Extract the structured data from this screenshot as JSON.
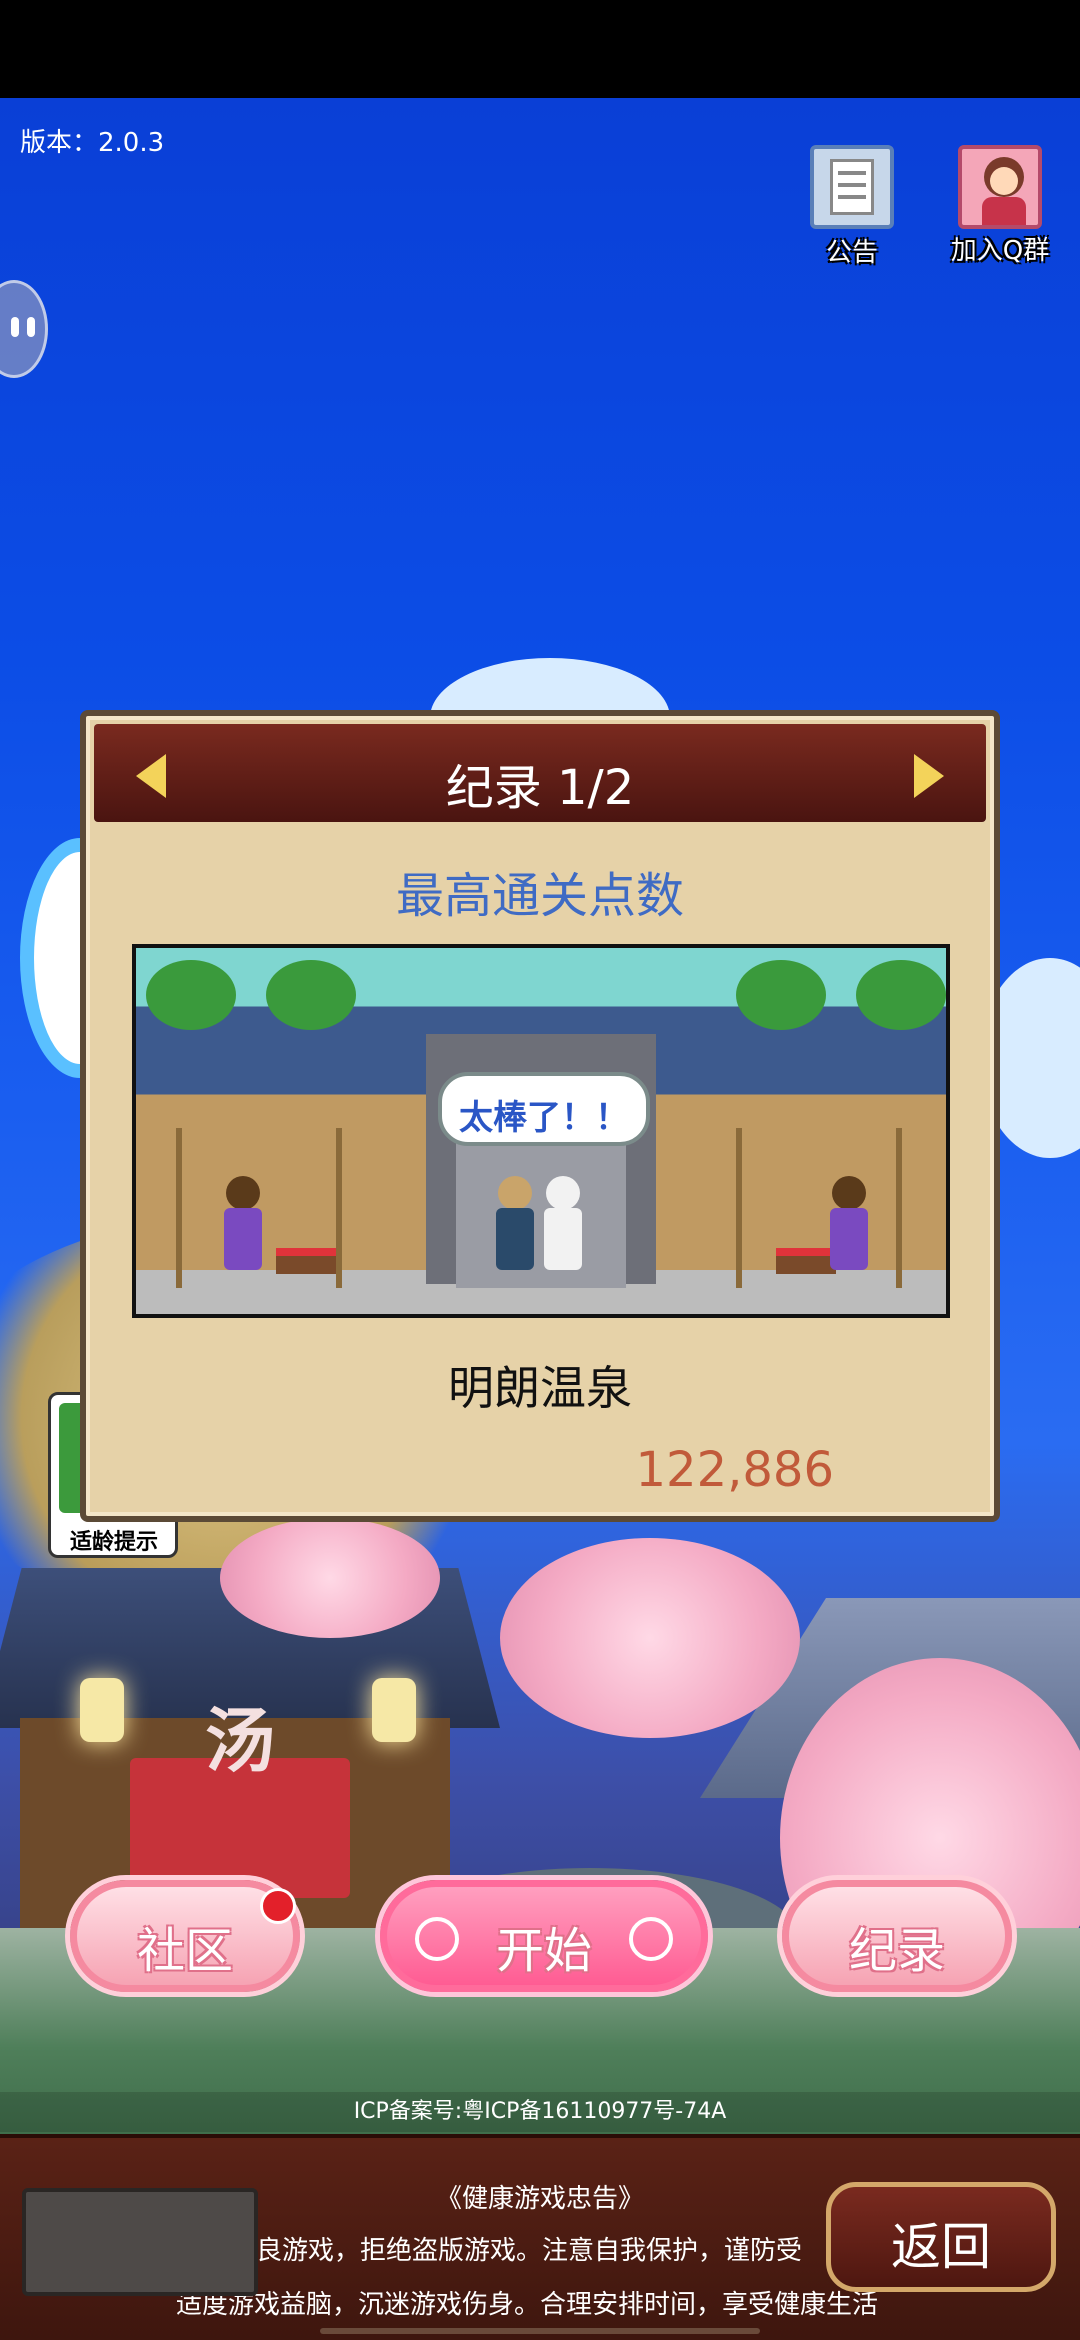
{
  "version_text": "版本：2.0.3",
  "top_icons": {
    "notice_label": "公告",
    "qq_label": "加入Q群"
  },
  "age_badge_label": "适龄提示",
  "dialog": {
    "title": "纪录 1/2",
    "subtitle": "最高通关点数",
    "bubble_text": "太棒了！！",
    "facility_name": "明朗温泉",
    "score": "122,886"
  },
  "scene_sign": "汤",
  "buttons": {
    "community": "社区",
    "start": "开始",
    "record": "纪录",
    "back": "返回"
  },
  "icp_text": "ICP备案号:粤ICP备16110977号-74A",
  "health": {
    "title": "《健康游戏忠告》",
    "line1": "良游戏，拒绝盗版游戏。注意自我保护，谨防受",
    "line2": "适度游戏益脑，沉迷游戏伤身。合理安排时间，享受健康生活"
  },
  "colors": {
    "sky": "#0c4de6",
    "dialog_bg": "#e6d2a8",
    "header": "#5a1a14",
    "subtitle": "#3f6bc4",
    "score": "#c15a3a",
    "pill": "#f6a3b3",
    "start_pill": "#ff5c93"
  }
}
